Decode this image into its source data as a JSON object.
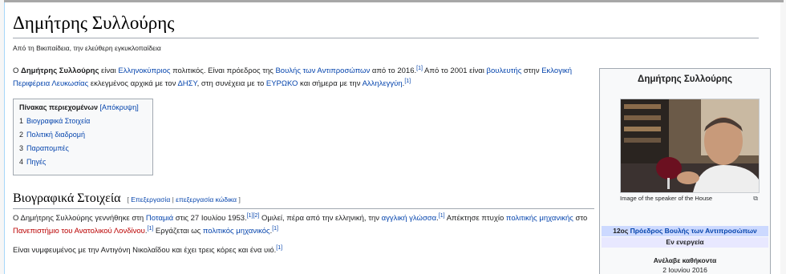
{
  "article": {
    "title": "Δημήτρης Συλλούρης",
    "tagline": "Από τη Βικιπαίδεια, την ελεύθερη εγκυκλοπαίδεια",
    "intro": {
      "t1": "Ο ",
      "name_bold": "Δημήτρης Συλλούρης",
      "t2": " είναι ",
      "l_cypriot": "Ελληνοκύπριος",
      "t3": " πολιτικός. Είναι πρόεδρος της ",
      "l_house": "Βουλής των Αντιπροσώπων",
      "t4": " από το 2016.",
      "r1": "[1]",
      "t5": " Από το 2001 είναι ",
      "l_mp": "βουλευτής",
      "t6": " στην ",
      "l_district": "Εκλογική Περιφέρεια Λευκωσίας",
      "t7": " εκλεγμένος αρχικά με τον ",
      "l_disy": "ΔΗΣΥ",
      "t8": ", στη συνέχεια με το ",
      "l_evroko": "ΕΥΡΩΚΟ",
      "t9": " και σήμερα με την ",
      "l_solidarity": "Αλληλεγγύη",
      "t10": ".",
      "r2": "[1]"
    },
    "toc": {
      "heading": "Πίνακας περιεχομένων",
      "toggle": "[Απόκρυψη]",
      "items": [
        {
          "num": "1",
          "label": "Βιογραφικά Στοιχεία"
        },
        {
          "num": "2",
          "label": "Πολιτική διαδρομή"
        },
        {
          "num": "3",
          "label": "Παραπομπές"
        },
        {
          "num": "4",
          "label": "Πηγές"
        }
      ]
    },
    "section1": {
      "heading": "Βιογραφικά Στοιχεία",
      "edit_open": "[ ",
      "edit": "Επεξεργασία",
      "edit_sep": " | ",
      "edit_source": "επεξεργασία κώδικα",
      "edit_close": " ]",
      "p1": {
        "t1": "Ο Δημήτρης Συλλούρης γεννήθηκε στη ",
        "l_potamia": "Ποταμιά",
        "t2": " στις 27 Ιουλίου 1953.",
        "r1": "[1][2]",
        "t3": " Ομιλεί, πέρα από την ελληνική, την ",
        "l_english": "αγγλική γλώσσα",
        "t4": ".",
        "r2": "[1]",
        "t5": " Απέκτησε πτυχίο ",
        "l_civil": "πολιτικής μηχανικής",
        "t6": " στο ",
        "l_university": "Πανεπιστήμιο του Ανατολικού Λονδίνου",
        "t7": ".",
        "r3": "[1]",
        "t8": " Εργάζεται ως ",
        "l_engineer": "πολιτικός μηχανικός",
        "t9": ".",
        "r4": "[1]"
      },
      "p2": {
        "t1": "Είναι νυμφευμένος με την Αντιγόνη Νικολαΐδου και έχει τρεις κόρες και ένα υιό.",
        "r1": "[1]"
      }
    }
  },
  "infobox": {
    "title": "Δημήτρης Συλλούρης",
    "caption": "Image of the speaker of the House",
    "expand_icon": "expand-icon",
    "office_ordinal": "12ος ",
    "office_link": "Πρόεδρος Βουλής των Αντιπροσώπων",
    "status": "Εν ενεργεία",
    "assumed_label": "Ανέλαβε καθήκοντα",
    "assumed_date": "2 Ιουνίου 2016"
  },
  "colors": {
    "link": "#0645ad",
    "redlink": "#ba0000",
    "office_bg": "#ccd9ff",
    "status_bg": "#e8e8ff"
  }
}
